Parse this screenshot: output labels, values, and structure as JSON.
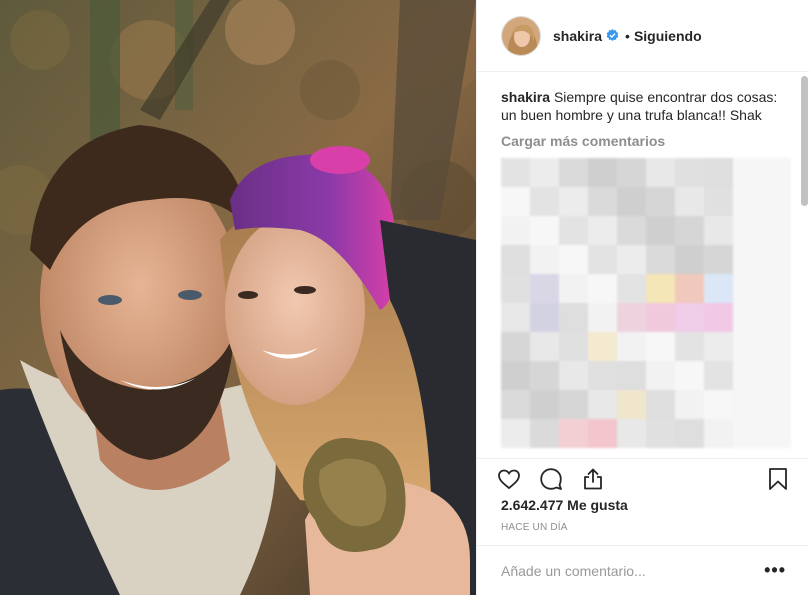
{
  "post": {
    "photo_alt": "selfie in the forest holding a white truffle",
    "username": "shakira",
    "verified": true,
    "separator": "•",
    "follow_status": "Siguiendo",
    "caption_user": "shakira",
    "caption_text": "Siempre quise encontrar dos cosas: un buen hombre y una trufa blanca!! Shak",
    "load_more": "Cargar más comentarios",
    "likes": "2.642.477 Me gusta",
    "time": "HACE UN DÍA",
    "comment_placeholder": "Añade un comentario...",
    "more_label": "•••"
  },
  "icons": {
    "like": "heart-icon",
    "comment": "speech-bubble-icon",
    "share": "share-icon",
    "save": "bookmark-icon",
    "verified": "verified-badge-icon"
  },
  "colors": {
    "text": "#262626",
    "muted": "#8e8e8e",
    "border": "#efefef",
    "verified_blue": "#3897f0"
  }
}
